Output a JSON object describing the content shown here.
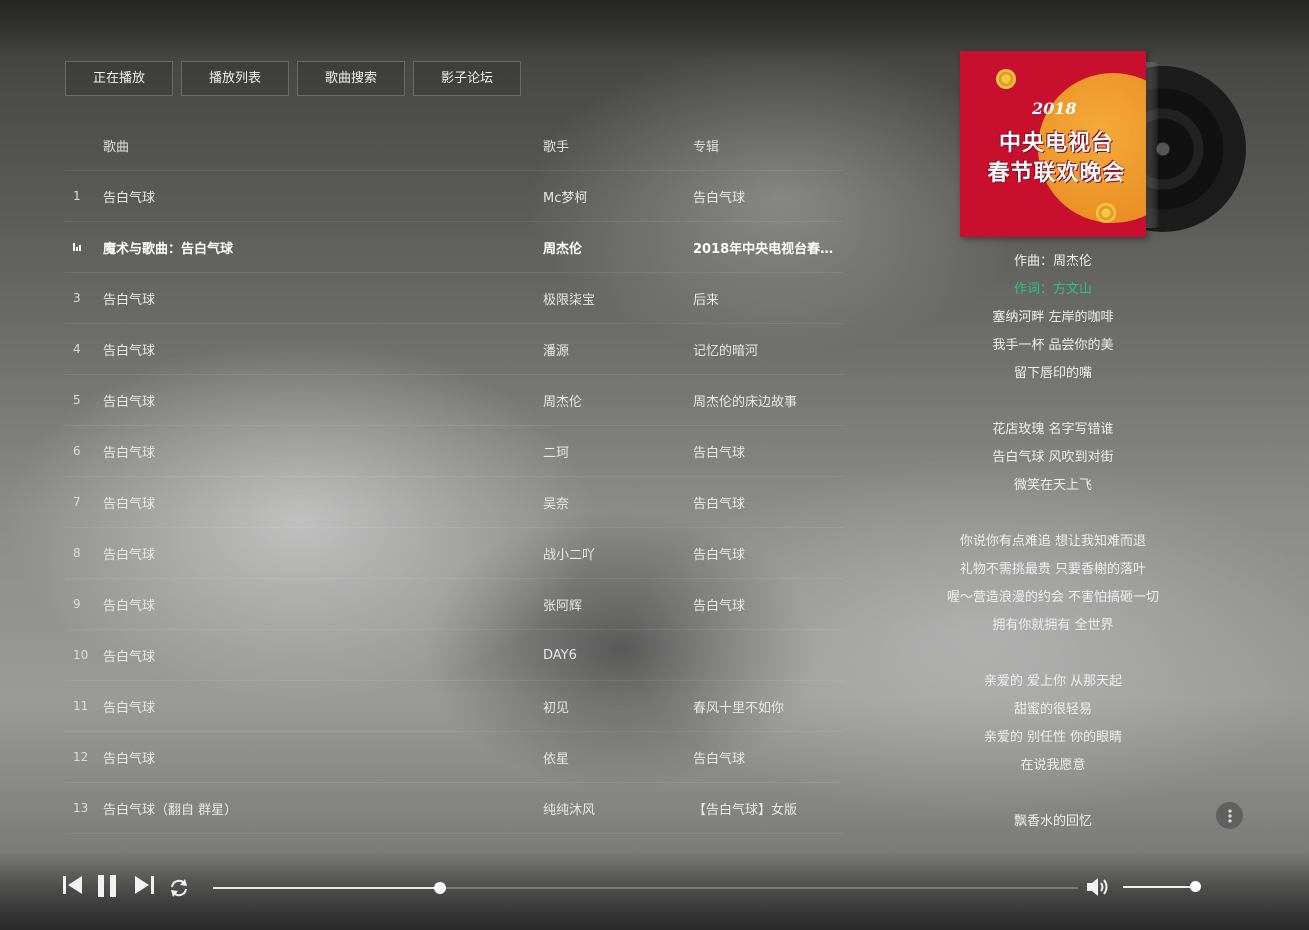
{
  "tabs": [
    "正在播放",
    "播放列表",
    "歌曲搜索",
    "影子论坛"
  ],
  "columns": {
    "song": "歌曲",
    "singer": "歌手",
    "album": "专辑"
  },
  "songs": [
    {
      "num": "1",
      "song": "告白气球",
      "singer": "Mc梦柯",
      "album": "告白气球"
    },
    {
      "num": "",
      "song": "魔术与歌曲：告白气球",
      "singer": "周杰伦",
      "album": "2018年中央电视台春…",
      "playing": true
    },
    {
      "num": "3",
      "song": "告白气球",
      "singer": "极限柒宝",
      "album": "后来"
    },
    {
      "num": "4",
      "song": "告白气球",
      "singer": "潘源",
      "album": "记忆的暗河"
    },
    {
      "num": "5",
      "song": "告白气球",
      "singer": "周杰伦",
      "album": "周杰伦的床边故事"
    },
    {
      "num": "6",
      "song": "告白气球",
      "singer": "二珂",
      "album": "告白气球"
    },
    {
      "num": "7",
      "song": "告白气球",
      "singer": "吴奈",
      "album": "告白气球"
    },
    {
      "num": "8",
      "song": "告白气球",
      "singer": "战小二吖",
      "album": "告白气球"
    },
    {
      "num": "9",
      "song": "告白气球",
      "singer": "张阿辉",
      "album": "告白气球"
    },
    {
      "num": "10",
      "song": "告白气球",
      "singer": "DAY6",
      "album": ""
    },
    {
      "num": "11",
      "song": "告白气球",
      "singer": "初见",
      "album": "春风十里不如你"
    },
    {
      "num": "12",
      "song": "告白气球",
      "singer": "依星",
      "album": "告白气球"
    },
    {
      "num": "13",
      "song": "告白气球（翻自 群星）",
      "singer": "纯纯沐风",
      "album": "【告白气球】女版"
    }
  ],
  "cover": {
    "year": "2018",
    "line1": "中央电视台",
    "line2": "春节联欢晚会"
  },
  "lyrics": [
    {
      "text": "作曲：周杰伦"
    },
    {
      "text": "作词：方文山",
      "current": true
    },
    {
      "text": "塞纳河畔 左岸的咖啡"
    },
    {
      "text": "我手一杯 品尝你的美"
    },
    {
      "text": "留下唇印的嘴"
    },
    {
      "text": ""
    },
    {
      "text": "花店玫瑰 名字写错谁"
    },
    {
      "text": "告白气球 风吹到对街"
    },
    {
      "text": "微笑在天上飞"
    },
    {
      "text": ""
    },
    {
      "text": "你说你有点难追 想让我知难而退"
    },
    {
      "text": "礼物不需挑最贵 只要香榭的落叶"
    },
    {
      "text": "喔～营造浪漫的约会 不害怕搞砸一切"
    },
    {
      "text": "拥有你就拥有 全世界"
    },
    {
      "text": ""
    },
    {
      "text": "亲爱的 爱上你 从那天起"
    },
    {
      "text": "甜蜜的很轻易"
    },
    {
      "text": "亲爱的 别任性 你的眼睛"
    },
    {
      "text": "在说我愿意"
    },
    {
      "text": ""
    },
    {
      "text": "飘香水的回忆"
    }
  ],
  "more_icon": "more-vertical-icon",
  "controls": {
    "prev": "prev-icon",
    "pause": "pause-icon",
    "next": "next-icon",
    "loop": "loop-icon",
    "volume": "volume-icon"
  },
  "playback": {
    "progress_fraction": 0.262,
    "volume_fraction": 1.0
  },
  "colors": {
    "accent": "#31c27c",
    "cover_red": "#c8102e"
  }
}
